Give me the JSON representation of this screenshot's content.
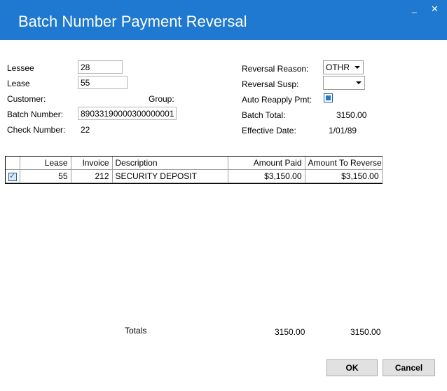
{
  "window": {
    "title": "Batch Number Payment Reversal",
    "minimize_glyph": "_",
    "close_glyph": "✕",
    "accent_color": "#1f79d1"
  },
  "form": {
    "lessee_label": "Lessee",
    "lessee_value": "28",
    "lease_label": "Lease",
    "lease_value": "55",
    "customer_label": "Customer:",
    "group_label": "Group:",
    "batch_number_label": "Batch Number:",
    "batch_number_value": "89033190000300000001",
    "check_number_label": "Check Number:",
    "check_number_value": "22",
    "reversal_reason_label": "Reversal Reason:",
    "reversal_reason_value": "OTHR",
    "reversal_susp_label": "Reversal Susp:",
    "reversal_susp_value": "",
    "auto_reapply_label": "Auto Reapply Pmt:",
    "auto_reapply_checked": true,
    "batch_total_label": "Batch Total:",
    "batch_total_value": "3150.00",
    "effective_date_label": "Effective Date:",
    "effective_date_value": "1/01/89"
  },
  "grid": {
    "columns": [
      "",
      "Lease",
      "Invoice",
      "Description",
      "Amount Paid",
      "Amount To Reverse"
    ],
    "rows": [
      {
        "checked": true,
        "lease": "55",
        "invoice": "212",
        "description": "SECURITY DEPOSIT",
        "amount_paid": "$3,150.00",
        "amount_to_reverse": "$3,150.00"
      }
    ]
  },
  "totals": {
    "label": "Totals",
    "amount_paid": "3150.00",
    "amount_to_reverse": "3150.00"
  },
  "buttons": {
    "ok": "OK",
    "cancel": "Cancel"
  }
}
